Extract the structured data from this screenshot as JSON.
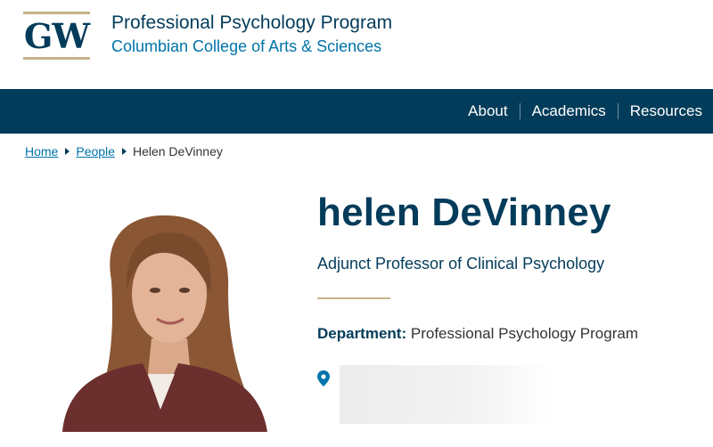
{
  "header": {
    "logo_text": "GW",
    "program_title": "Professional Psychology Program",
    "college_title": "Columbian College of Arts & Sciences"
  },
  "nav": {
    "items": [
      {
        "label": "About"
      },
      {
        "label": "Academics"
      },
      {
        "label": "Resources"
      }
    ]
  },
  "breadcrumb": {
    "items": [
      {
        "label": "Home"
      },
      {
        "label": "People"
      }
    ],
    "current": "Helen DeVinney"
  },
  "profile": {
    "name": "helen DeVinney",
    "role": "Adjunct Professor of Clinical Psychology",
    "department_label": "Department:",
    "department_value": "Professional Psychology Program"
  },
  "colors": {
    "brand_navy": "#033c5a",
    "brand_link": "#0073aa",
    "brand_gold": "#c7b387"
  },
  "icons": {
    "location": "map-pin-icon",
    "breadcrumb_separator": "caret-right-icon"
  }
}
